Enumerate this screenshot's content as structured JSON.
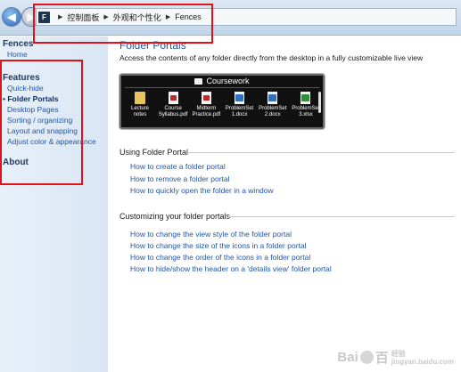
{
  "address_bar": {
    "app_icon": "F",
    "crumbs": [
      "控制面板",
      "外观和个性化",
      "Fences"
    ]
  },
  "sidebar": {
    "heading_fences": "Fences",
    "home": "Home",
    "heading_features": "Features",
    "items": [
      "Quick-hide",
      "Folder Portals",
      "Desktop Pages",
      "Sorting / organizing",
      "Layout and snapping",
      "Adjust color & appearance"
    ],
    "current_index": 1,
    "heading_about": "About"
  },
  "main": {
    "title": "Folder Portals",
    "subtitle": "Access the contents of any folder directly from the desktop in a fully customizable live view",
    "portal": {
      "header": "Coursework",
      "files": [
        {
          "name": "Lecture notes",
          "type": "folder"
        },
        {
          "name": "Course\nSyllabus.pdf",
          "type": "pdf"
        },
        {
          "name": "Midterm\nPractice.pdf",
          "type": "pdf"
        },
        {
          "name": "ProblemSet\n1.docx",
          "type": "docx"
        },
        {
          "name": "ProblemSet\n2.docx",
          "type": "docx"
        },
        {
          "name": "ProblemSet\n3.xlsx",
          "type": "xlsx"
        }
      ]
    },
    "section1": {
      "heading": "Using Folder Portal",
      "links": [
        "How to create a folder portal",
        "How to remove a folder portal",
        "How to quickly open the folder in a window"
      ]
    },
    "section2": {
      "heading": "Customizing your folder portals",
      "links": [
        "How to change the view style of the folder portal",
        "How to change the size of the icons in a folder portal",
        "How to change the order of the icons in a folder portal",
        "How to hide/show the header on a 'details view' folder portal"
      ]
    }
  },
  "watermark": {
    "text_a": "Bai",
    "text_b": "百",
    "sub_a": "经验",
    "sub_b": "jingyan.baidu.com"
  },
  "colors": {
    "annotation_red": "#e2111a",
    "link_blue": "#1f56a8",
    "title_blue": "#1e5ba8"
  }
}
